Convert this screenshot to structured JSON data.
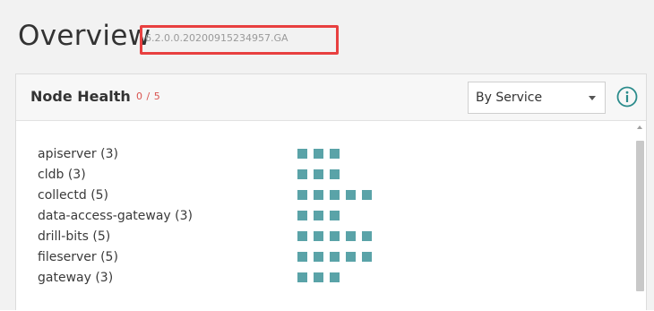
{
  "header": {
    "title": "Overview",
    "version": "6.2.0.0.20200915234957.GA"
  },
  "panel": {
    "title": "Node Health",
    "count": "0 / 5",
    "view_select": {
      "selected": "By Service"
    },
    "info_icon": "info-circle-icon",
    "services": [
      {
        "name": "apiserver",
        "count": "(3)",
        "nodes": 3
      },
      {
        "name": "cldb",
        "count": "(3)",
        "nodes": 3
      },
      {
        "name": "collectd",
        "count": "(5)",
        "nodes": 5
      },
      {
        "name": "data-access-gateway",
        "count": "(3)",
        "nodes": 3
      },
      {
        "name": "drill-bits",
        "count": "(5)",
        "nodes": 5
      },
      {
        "name": "fileserver",
        "count": "(5)",
        "nodes": 5
      },
      {
        "name": "gateway",
        "count": "(3)",
        "nodes": 3
      }
    ]
  },
  "colors": {
    "node_healthy": "#5aa3a8",
    "count_text": "#d9534f",
    "highlight_border": "#e84040",
    "info_icon": "#2c8c8c"
  }
}
